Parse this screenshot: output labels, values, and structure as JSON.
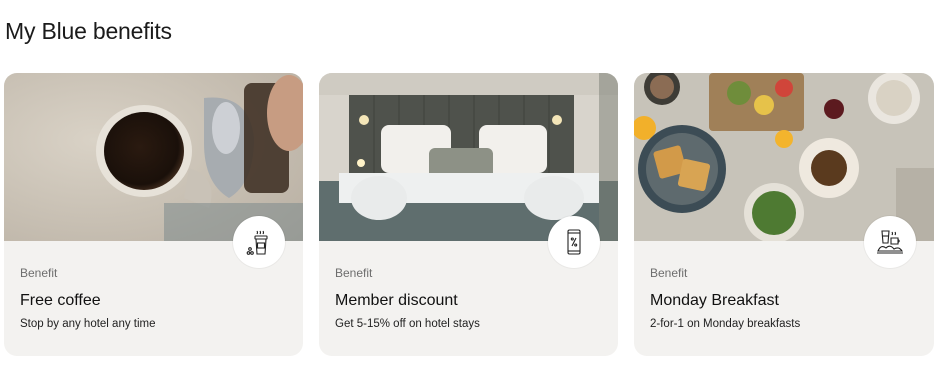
{
  "section": {
    "title": "My Blue benefits"
  },
  "cards": [
    {
      "tag": "Benefit",
      "title": "Free coffee",
      "description": "Stop by any hotel any time",
      "image": "coffee-pour-photo",
      "badge_icon": "coffee-cup-icon"
    },
    {
      "tag": "Benefit",
      "title": "Member discount",
      "description": "Get 5-15% off on hotel stays",
      "image": "hotel-bedroom-photo",
      "badge_icon": "phone-percent-icon"
    },
    {
      "tag": "Benefit",
      "title": "Monday Breakfast",
      "description": "2-for-1 on Monday breakfasts",
      "image": "breakfast-table-photo",
      "badge_icon": "breakfast-icon"
    }
  ],
  "colors": {
    "card_background": "#f3f2f0",
    "badge_background": "#ffffff",
    "tag_text": "#6d6d6d"
  }
}
